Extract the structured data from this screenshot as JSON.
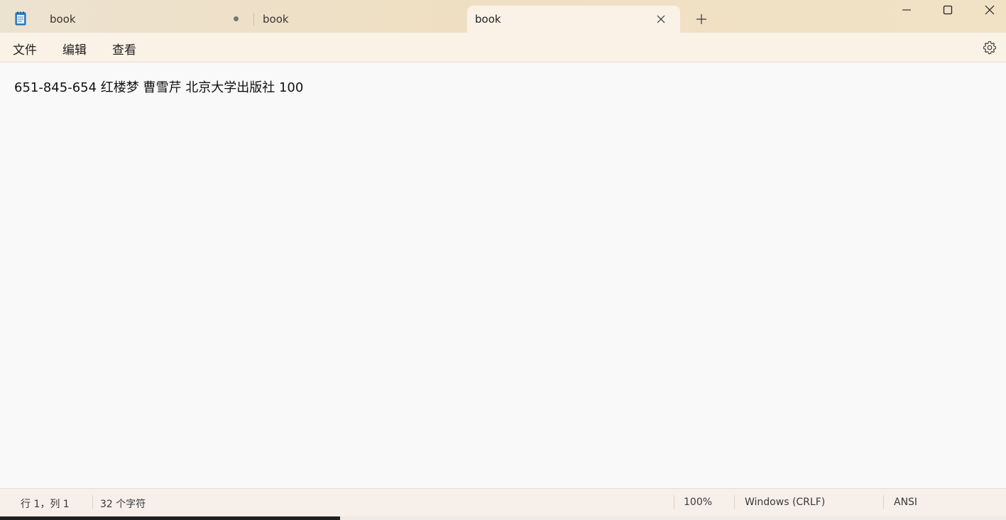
{
  "tabs": [
    {
      "label": "book",
      "modified": true,
      "active": false
    },
    {
      "label": "book",
      "modified": false,
      "active": false
    },
    {
      "label": "book",
      "modified": false,
      "active": true
    }
  ],
  "icons": {
    "app": "notepad-icon",
    "tab_close": "close-icon",
    "new_tab": "plus-icon",
    "minimize": "minimize-icon",
    "maximize": "maximize-icon",
    "close": "close-icon",
    "settings": "gear-icon"
  },
  "menu": {
    "file": "文件",
    "edit": "编辑",
    "view": "查看"
  },
  "editor": {
    "content": "651-845-654 红楼梦 曹雪芹 北京大学出版社 100"
  },
  "status": {
    "position": "行 1，列 1",
    "char_count": "32 个字符",
    "zoom": "100%",
    "line_ending": "Windows (CRLF)",
    "encoding": "ANSI"
  },
  "colors": {
    "titlebar": "#efdfc2",
    "active_tab": "#faf2e6",
    "editor_bg": "#f9f9f9",
    "statusbar": "#f6efea"
  }
}
